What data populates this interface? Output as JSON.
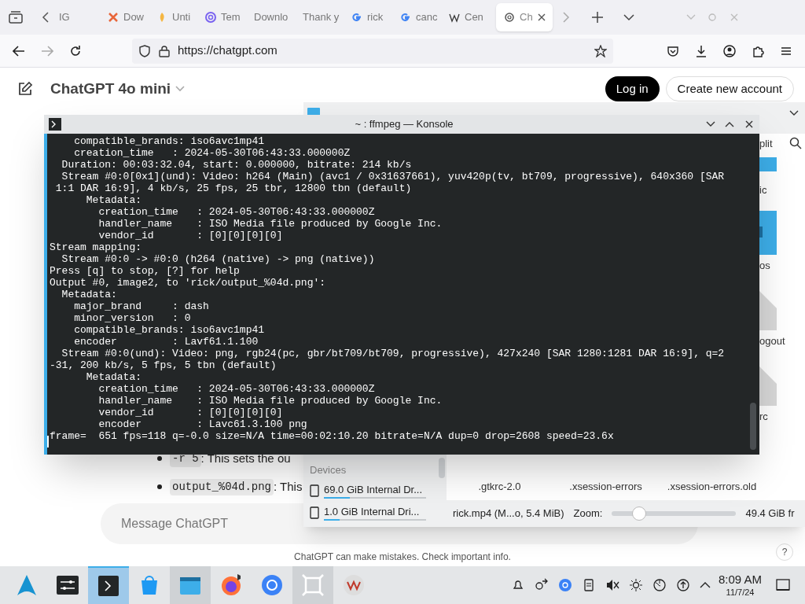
{
  "browser": {
    "tabs": [
      {
        "label": "IG",
        "kind": "plain",
        "selected": false
      },
      {
        "label": "Dow",
        "kind": "x",
        "selected": false
      },
      {
        "label": "Unti",
        "kind": "coin",
        "selected": false
      },
      {
        "label": "Tem",
        "kind": "at",
        "selected": false
      },
      {
        "label": "Downlo",
        "kind": "plain",
        "selected": false
      },
      {
        "label": "Thank y",
        "kind": "plain",
        "selected": false
      },
      {
        "label": "rick",
        "kind": "g",
        "selected": false
      },
      {
        "label": "canc",
        "kind": "g",
        "selected": false
      },
      {
        "label": "Cen",
        "kind": "w",
        "selected": false
      },
      {
        "label": "Ch",
        "kind": "knot",
        "selected": true
      }
    ],
    "url": "https://chatgpt.com"
  },
  "chat": {
    "model": "ChatGPT 4o mini",
    "login": "Log in",
    "signup": "Create new account",
    "bullets": [
      {
        "code": "-r 5",
        "text": ": This sets the ou"
      },
      {
        "code": "output_%04d.png",
        "text": ": This"
      }
    ],
    "placeholder": "Message ChatGPT",
    "footer": "ChatGPT can make mistakes. Check important info.",
    "help": "?"
  },
  "dolphin": {
    "toolbar_label": "plit",
    "side_labels": [
      "ic",
      "os",
      "ogout",
      "rc"
    ],
    "devices_heading": "Devices",
    "devices": [
      {
        "label": "69.0 GiB Internal Dr...",
        "level": 0.25
      },
      {
        "label": "1.0 GiB Internal Dri...",
        "level": 0.15
      }
    ],
    "files": [
      ".gtkrc-2.0",
      ".xsession-errors",
      ".xsession-errors.old"
    ],
    "status": "rick.mp4 (M...o, 5.4 MiB)",
    "zoom_label": "Zoom:",
    "zoom": {
      "level": 0.22
    },
    "free_space": "49.4 GiB fr"
  },
  "konsole": {
    "title": "~ : ffmpeg — Konsole",
    "lines": [
      "    compatible_brands: iso6avc1mp41",
      "    creation_time   : 2024-05-30T06:43:33.000000Z",
      "  Duration: 00:03:32.04, start: 0.000000, bitrate: 214 kb/s",
      "  Stream #0:0[0x1](und): Video: h264 (Main) (avc1 / 0x31637661), yuv420p(tv, bt709, progressive), 640x360 [SAR",
      " 1:1 DAR 16:9], 4 kb/s, 25 fps, 25 tbr, 12800 tbn (default)",
      "      Metadata:",
      "        creation_time   : 2024-05-30T06:43:33.000000Z",
      "        handler_name    : ISO Media file produced by Google Inc.",
      "        vendor_id       : [0][0][0][0]",
      "Stream mapping:",
      "  Stream #0:0 -> #0:0 (h264 (native) -> png (native))",
      "Press [q] to stop, [?] for help",
      "Output #0, image2, to 'rick/output_%04d.png':",
      "  Metadata:",
      "    major_brand     : dash",
      "    minor_version   : 0",
      "    compatible_brands: iso6avc1mp41",
      "    encoder         : Lavf61.1.100",
      "  Stream #0:0(und): Video: png, rgb24(pc, gbr/bt709/bt709, progressive), 427x240 [SAR 1280:1281 DAR 16:9], q=2",
      "-31, 200 kb/s, 5 fps, 5 tbn (default)",
      "      Metadata:",
      "        creation_time   : 2024-05-30T06:43:33.000000Z",
      "        handler_name    : ISO Media file produced by Google Inc.",
      "        vendor_id       : [0][0][0][0]",
      "        encoder         : Lavc61.3.100 png",
      "frame=  651 fps=118 q=-0.0 size=N/A time=00:02:10.20 bitrate=N/A dup=0 drop=2608 speed=23.6x"
    ]
  },
  "taskbar": {
    "apps": [
      {
        "kind": "launcher",
        "selected": false,
        "open": false
      },
      {
        "kind": "settings",
        "selected": false,
        "open": false
      },
      {
        "kind": "terminal",
        "selected": true,
        "open": true
      },
      {
        "kind": "store",
        "selected": false,
        "open": false
      },
      {
        "kind": "files",
        "selected": false,
        "open": true
      },
      {
        "kind": "browser",
        "selected": false,
        "open": false
      },
      {
        "kind": "torrent",
        "selected": false,
        "open": false
      },
      {
        "kind": "frame",
        "selected": false,
        "open": true
      },
      {
        "kind": "vm",
        "selected": false,
        "open": false
      }
    ],
    "time": "8:09 AM",
    "date": "11/7/24"
  }
}
